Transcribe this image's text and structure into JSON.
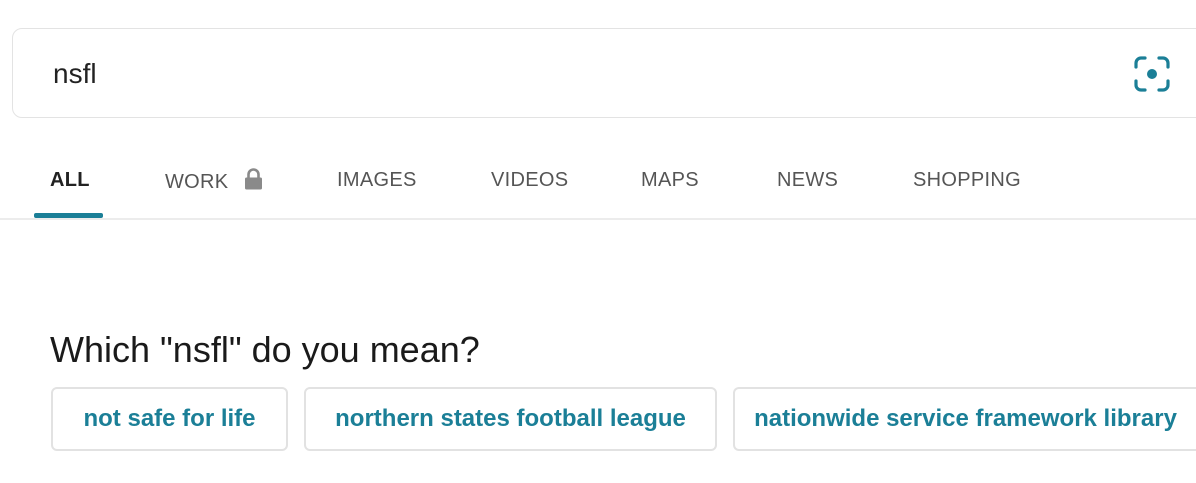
{
  "search": {
    "query": "nsfl",
    "lens_icon": "camera-lens-icon"
  },
  "tabs": [
    {
      "label": "ALL",
      "active": true
    },
    {
      "label": "WORK",
      "active": false,
      "icon": "lock-icon"
    },
    {
      "label": "IMAGES",
      "active": false
    },
    {
      "label": "VIDEOS",
      "active": false
    },
    {
      "label": "MAPS",
      "active": false
    },
    {
      "label": "NEWS",
      "active": false
    },
    {
      "label": "SHOPPING",
      "active": false
    }
  ],
  "disambiguation": {
    "heading": "Which \"nsfl\" do you mean?",
    "options": [
      "not safe for life",
      "northern states football league",
      "nationwide service framework library"
    ]
  },
  "colors": {
    "accent": "#1b7f97",
    "text": "#222222",
    "muted": "#555555",
    "border": "#e2e2e2"
  }
}
